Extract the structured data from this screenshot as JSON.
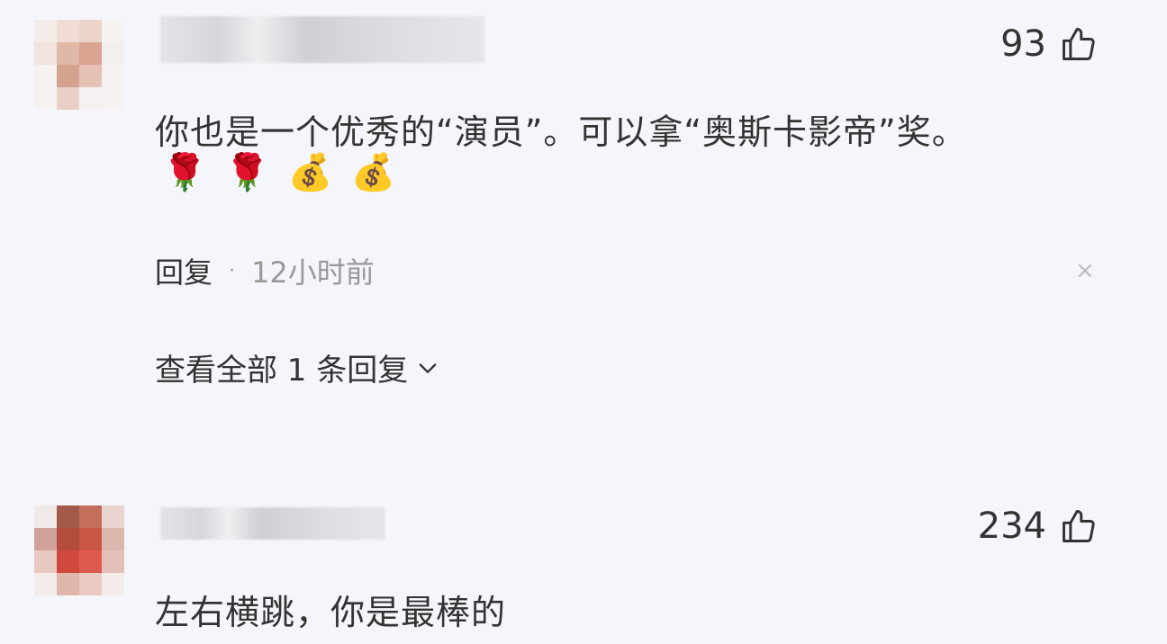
{
  "comments": [
    {
      "avatar_colors": [
        "#f3ece9",
        "#f0dcd5",
        "#ecd3ca",
        "#f6f2f1",
        "#f1e3de",
        "#e0b8a8",
        "#d9a492",
        "#f4efee",
        "#f6f2f1",
        "#d3a390",
        "#e6c2b6",
        "#f5f1f0",
        "#f6f2f1",
        "#e9cfc6",
        "#f5f1f0",
        "#f6f2f1"
      ],
      "likes": "93",
      "text": "你也是一个优秀的“演员”。可以拿“奥斯卡影帝”奖。",
      "emojis": [
        "🌹",
        "🌹",
        "💰",
        "💰"
      ],
      "reply_label": "回复",
      "separator": "·",
      "time": "12小时前",
      "close_glyph": "×",
      "view_all": "查看全部 1 条回复"
    },
    {
      "avatar_colors": [
        "#f1e9e7",
        "#a45a48",
        "#c36f5c",
        "#e9d4cf",
        "#d1a398",
        "#b34c3a",
        "#c95744",
        "#dbb7ad",
        "#e7c9c2",
        "#cf4a3c",
        "#dd5a4d",
        "#e2c0b8",
        "#f3ece9",
        "#e1b7ab",
        "#eac9c0",
        "#f3ece9"
      ],
      "likes": "234",
      "text": "左右横跳，你是最棒的"
    }
  ],
  "colors": {
    "background": "#f5f6fb",
    "text": "#333333",
    "muted": "#999999"
  }
}
